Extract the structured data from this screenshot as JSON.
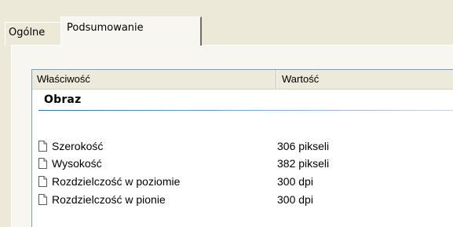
{
  "tabs": [
    {
      "label": "Ogólne",
      "selected": false
    },
    {
      "label": "Podsumowanie",
      "selected": true
    }
  ],
  "list": {
    "columns": {
      "property": "Właściwość",
      "value": "Wartość"
    },
    "group": {
      "title": "Obraz"
    },
    "rows": [
      {
        "icon": "document-icon",
        "name": "Szerokość",
        "value": "306 pikseli"
      },
      {
        "icon": "document-icon",
        "name": "Wysokość",
        "value": "382 pikseli"
      },
      {
        "icon": "document-icon",
        "name": "Rozdzielczość w poziomie",
        "value": "300 dpi"
      },
      {
        "icon": "document-icon",
        "name": "Rozdzielczość w pionie",
        "value": "300 dpi"
      }
    ]
  },
  "colors": {
    "window_background": "#ece9d8",
    "panel_background": "#f7f6f0",
    "group_line": "#3a6ea5",
    "list_border": "#7f9db9"
  }
}
